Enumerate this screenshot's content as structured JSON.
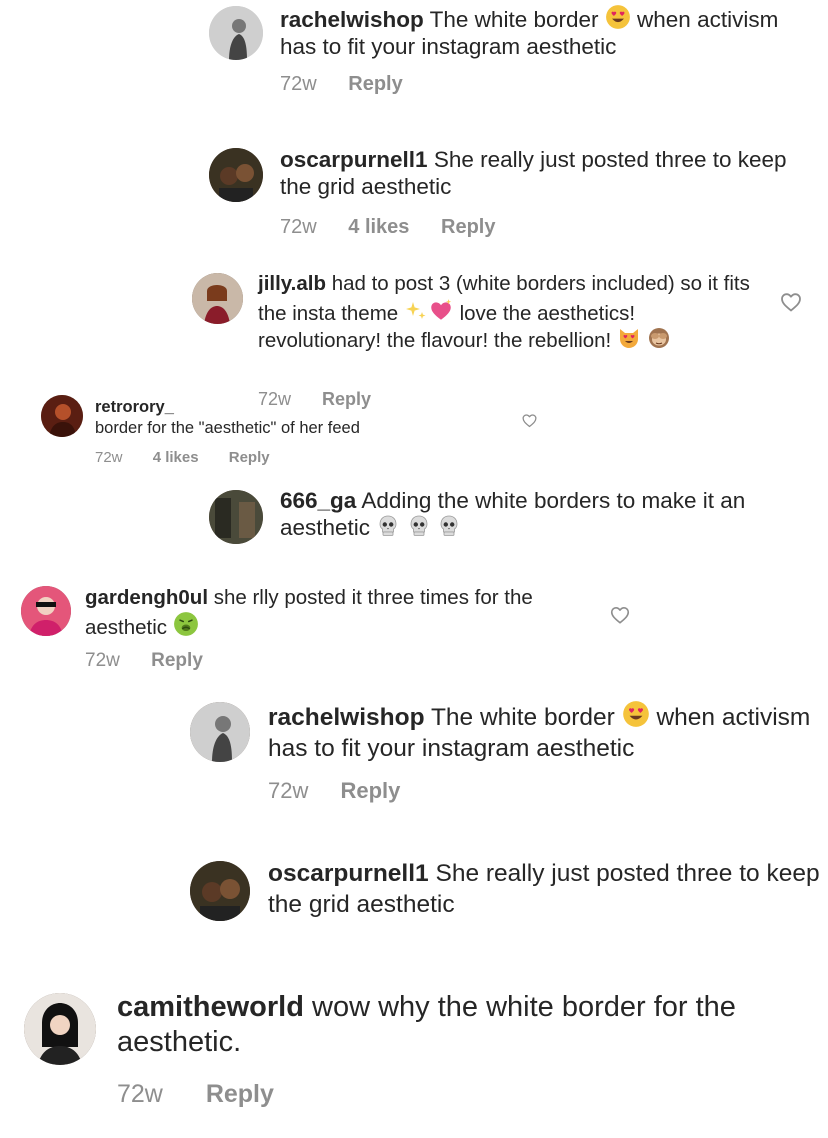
{
  "comments": [
    {
      "username": "rachelwishop",
      "text": "The white border",
      "text2": "when activism has to fit your instagram aesthetic",
      "time": "72w",
      "reply": "Reply"
    },
    {
      "username": "oscarpurnell1",
      "text": "She really just posted three to keep the grid aesthetic",
      "time": "72w",
      "likes": "4 likes",
      "reply": "Reply"
    },
    {
      "username": "jilly.alb",
      "text": "had to post 3 (white borders included) so it fits the insta theme",
      "text2": "love the aesthetics! revolutionary! the flavour! the rebellion!",
      "time": "72w",
      "reply": "Reply"
    },
    {
      "username": "retrorory_",
      "text": "border for the \"aesthetic\" of her feed",
      "time": "72w",
      "likes": "4 likes",
      "reply": "Reply"
    },
    {
      "username": "666_ga",
      "text": "Adding the white borders to make it an aesthetic"
    },
    {
      "username": "gardengh0ul",
      "text": "she rlly posted it three times for the aesthetic",
      "time": "72w",
      "reply": "Reply"
    },
    {
      "username": "rachelwishop",
      "text": "The white border",
      "text2": "when activism has to fit your instagram aesthetic",
      "time": "72w",
      "reply": "Reply"
    },
    {
      "username": "oscarpurnell1",
      "text": "She really just posted three to keep the grid aesthetic"
    },
    {
      "username": "camitheworld",
      "text": "wow why the white border for the aesthetic.",
      "time": "72w",
      "reply": "Reply"
    }
  ],
  "icons": {
    "heart": "heart-outline-icon",
    "emoji_heart_eyes": "heart-eyes-emoji",
    "emoji_sparkles": "sparkles-emoji",
    "emoji_sparkling_heart": "sparkling-heart-emoji",
    "emoji_cat": "heart-eyes-cat-emoji",
    "emoji_monkey": "see-no-evil-monkey-emoji",
    "emoji_skull": "skull-emoji",
    "emoji_nauseated": "nauseated-face-emoji"
  },
  "colors": {
    "text": "#262626",
    "muted": "#8e8e8e",
    "background": "#ffffff"
  }
}
